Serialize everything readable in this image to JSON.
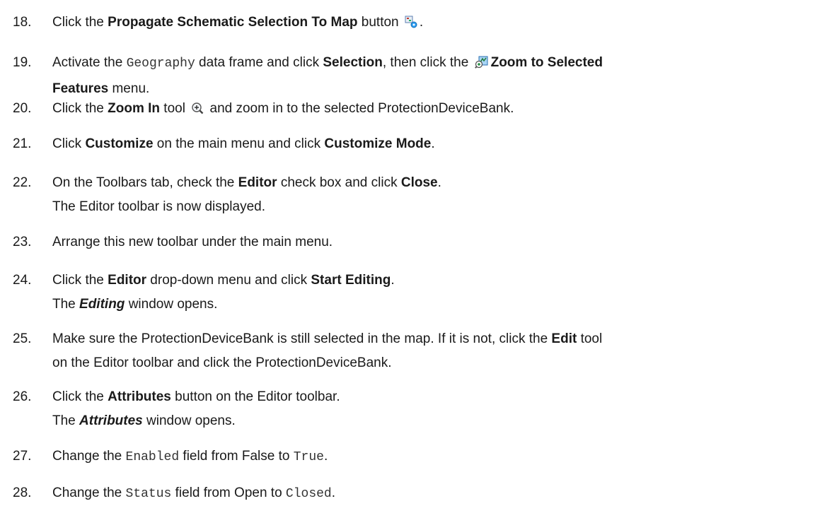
{
  "steps": [
    {
      "num": "18.",
      "lines": [
        [
          {
            "t": "Click the "
          },
          {
            "t": "Propagate Schematic Selection To Map",
            "s": "b"
          },
          {
            "t": " button "
          },
          {
            "icon": "propagate-selection-icon"
          },
          {
            "t": "."
          }
        ]
      ]
    },
    {
      "num": "19.",
      "lines": [
        [
          {
            "t": "Activate the "
          },
          {
            "t": "Geography",
            "s": "mono"
          },
          {
            "t": " data frame and click "
          },
          {
            "t": "Selection",
            "s": "b"
          },
          {
            "t": ", then click the "
          },
          {
            "icon": "zoom-to-selected-icon"
          },
          {
            "t": "Zoom to Selected",
            "s": "b"
          }
        ],
        [
          {
            "t": "Features",
            "s": "b"
          },
          {
            "t": " menu."
          }
        ]
      ]
    },
    {
      "num": "20.",
      "lines": [
        [
          {
            "t": "Click the "
          },
          {
            "t": "Zoom In",
            "s": "b"
          },
          {
            "t": " tool "
          },
          {
            "icon": "zoom-in-icon"
          },
          {
            "t": " and zoom in to the selected ProtectionDeviceBank."
          }
        ]
      ]
    },
    {
      "num": "21.",
      "lines": [
        [
          {
            "t": "Click "
          },
          {
            "t": "Customize",
            "s": "b"
          },
          {
            "t": " on the main menu and click "
          },
          {
            "t": "Customize Mode",
            "s": "b"
          },
          {
            "t": "."
          }
        ]
      ]
    },
    {
      "num": "22.",
      "lines": [
        [
          {
            "t": "On the Toolbars tab, check the "
          },
          {
            "t": "Editor",
            "s": "b"
          },
          {
            "t": " check box and click "
          },
          {
            "t": "Close",
            "s": "b"
          },
          {
            "t": "."
          }
        ],
        [
          {
            "t": "The Editor toolbar is now displayed."
          }
        ]
      ]
    },
    {
      "num": "23.",
      "lines": [
        [
          {
            "t": "Arrange this new toolbar under the main menu."
          }
        ]
      ]
    },
    {
      "num": "24.",
      "lines": [
        [
          {
            "t": "Click the "
          },
          {
            "t": "Editor",
            "s": "b"
          },
          {
            "t": " drop-down menu and click "
          },
          {
            "t": "Start Editing",
            "s": "b"
          },
          {
            "t": "."
          }
        ],
        [
          {
            "t": "The "
          },
          {
            "t": "Editing",
            "s": "bi"
          },
          {
            "t": " window opens."
          }
        ]
      ]
    },
    {
      "num": "25.",
      "lines": [
        [
          {
            "t": "Make sure the ProtectionDeviceBank is still selected in the map. If it is not, click the "
          },
          {
            "t": "Edit",
            "s": "b"
          },
          {
            "t": " tool"
          }
        ],
        [
          {
            "t": "on the Editor toolbar and click the ProtectionDeviceBank."
          }
        ]
      ]
    },
    {
      "num": "26.",
      "lines": [
        [
          {
            "t": "Click the "
          },
          {
            "t": "Attributes",
            "s": "b"
          },
          {
            "t": " button on the Editor toolbar."
          }
        ],
        [
          {
            "t": "The "
          },
          {
            "t": "Attributes",
            "s": "bi"
          },
          {
            "t": " window opens."
          }
        ]
      ]
    },
    {
      "num": "27.",
      "lines": [
        [
          {
            "t": "Change the "
          },
          {
            "t": "Enabled",
            "s": "mono"
          },
          {
            "t": " field from False to "
          },
          {
            "t": "True",
            "s": "mono"
          },
          {
            "t": "."
          }
        ]
      ]
    },
    {
      "num": "28.",
      "lines": [
        [
          {
            "t": "Change the "
          },
          {
            "t": "Status",
            "s": "mono"
          },
          {
            "t": " field from Open to "
          },
          {
            "t": "Closed",
            "s": "mono"
          },
          {
            "t": "."
          }
        ]
      ]
    }
  ]
}
